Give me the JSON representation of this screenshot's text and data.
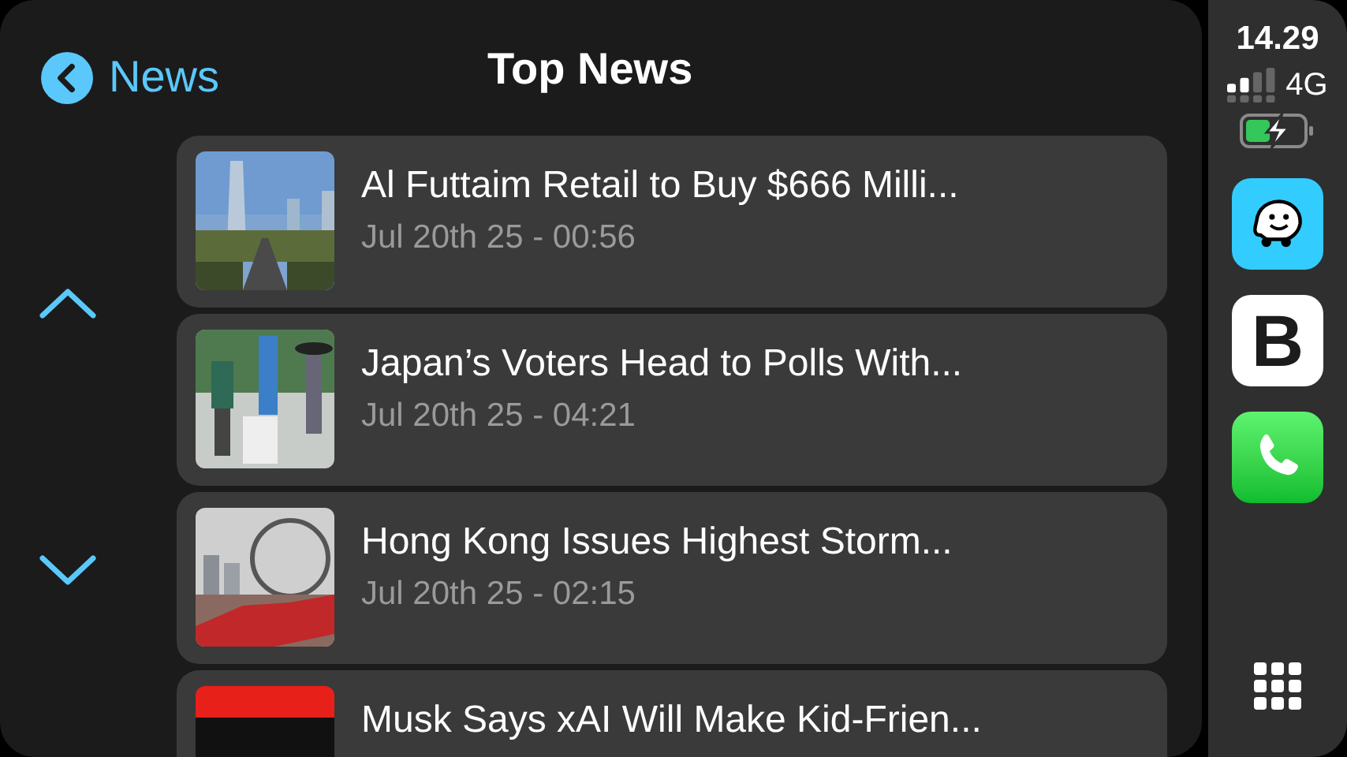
{
  "header": {
    "back_label": "News",
    "title": "Top News"
  },
  "articles": [
    {
      "title": "Al Futtaim Retail to Buy $666 Milli...",
      "date": "Jul 20th 25 - 00:56"
    },
    {
      "title": "Japan’s Voters Head to Polls With...",
      "date": "Jul 20th 25 - 04:21"
    },
    {
      "title": "Hong Kong Issues Highest Storm...",
      "date": "Jul 20th 25 - 02:15"
    },
    {
      "title": "Musk Says xAI Will Make Kid-Frien..."
    }
  ],
  "status": {
    "time": "14.29",
    "network": "4G"
  },
  "dock": [
    {
      "kind": "waze"
    },
    {
      "kind": "letter",
      "letter": "B"
    },
    {
      "kind": "phone"
    }
  ]
}
